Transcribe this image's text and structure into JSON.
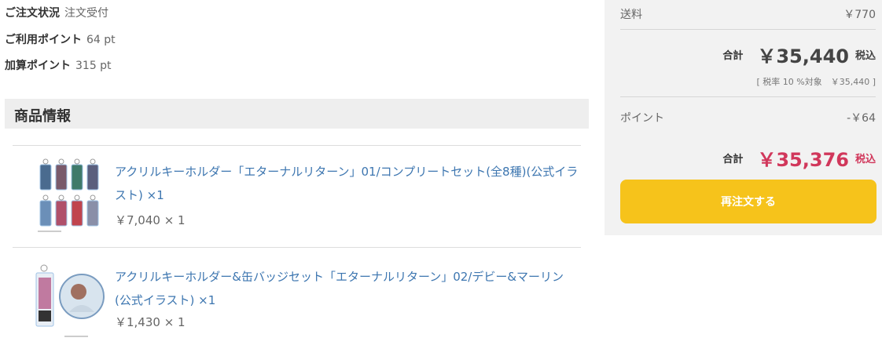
{
  "order": {
    "status_label": "ご注文状況",
    "status_value": "注文受付",
    "used_points_label": "ご利用ポイント",
    "used_points_value": "64 pt",
    "added_points_label": "加算ポイント",
    "added_points_value": "315 pt"
  },
  "products_section": {
    "title": "商品情報",
    "items": [
      {
        "title": "アクリルキーホルダー「エターナルリターン」01/コンプリートセット(全8種)(公式イラスト) ×1",
        "price": "￥7,040 × 1"
      },
      {
        "title": "アクリルキーホルダー&缶バッジセット「エターナルリターン」02/デビー&マーリン(公式イラスト) ×1",
        "price": "￥1,430 × 1"
      }
    ]
  },
  "summary": {
    "shipping_label": "送料",
    "shipping_value": "￥770",
    "total_label": "合計",
    "total_amount": "￥35,440",
    "total_tax": "税込",
    "tax_note": "[ 税率 10 %対象　￥35,440 ]",
    "points_label": "ポイント",
    "points_value": "-￥64",
    "final_label": "合計",
    "final_amount": "￥35,376",
    "final_tax": "税込",
    "reorder_button": "再注文する"
  },
  "colors": {
    "accent_red": "#d1375b",
    "button_yellow": "#f6c31b",
    "link_blue": "#3d76b0"
  }
}
